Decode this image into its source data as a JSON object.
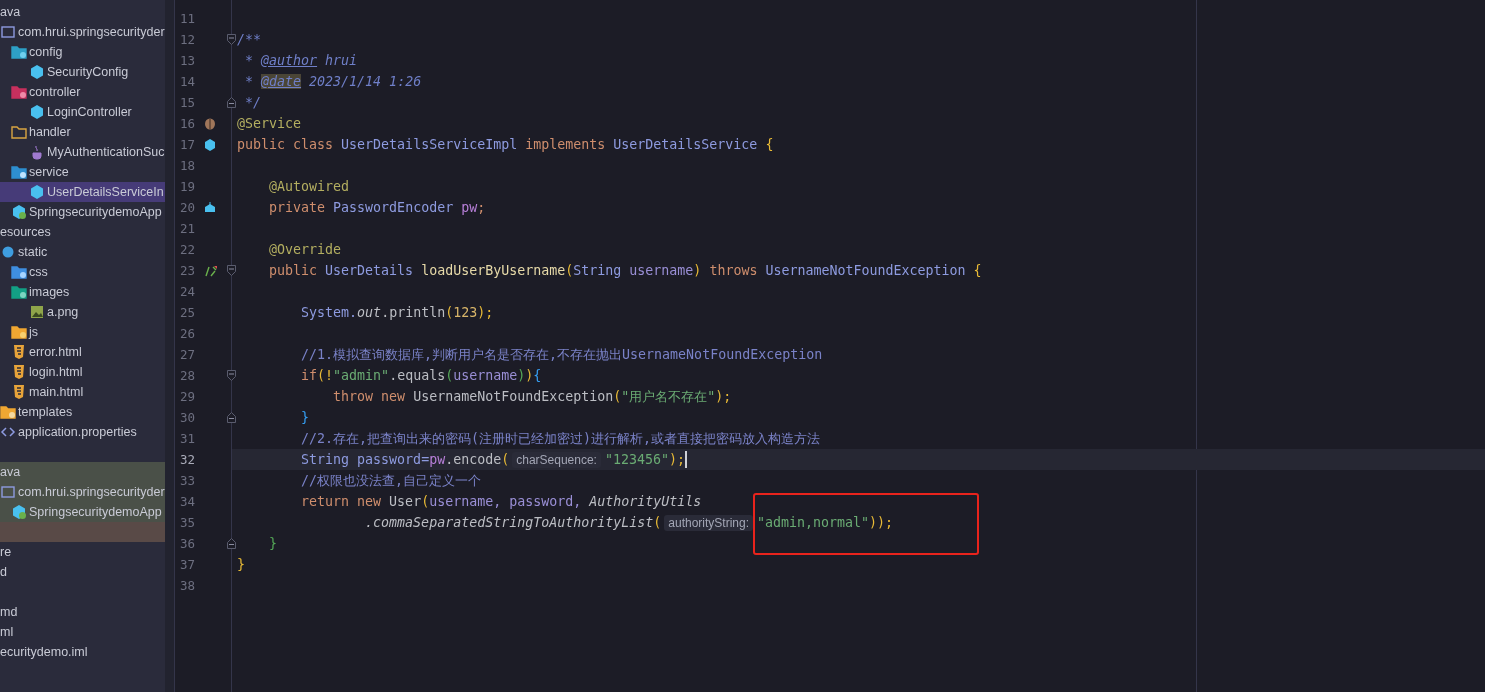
{
  "project_tree": [
    {
      "label": "ava",
      "kind": "plain",
      "selected": false,
      "children": [
        {
          "label": "com.hrui.springsecurityder",
          "kind": "package",
          "selected": false,
          "children": [
            {
              "label": "config",
              "kind": "config-folder",
              "selected": false,
              "children": [
                {
                  "label": "SecurityConfig",
                  "kind": "class",
                  "selected": false
                }
              ]
            },
            {
              "label": "controller",
              "kind": "controller-folder",
              "selected": false,
              "children": [
                {
                  "label": "LoginController",
                  "kind": "class",
                  "selected": false
                }
              ]
            },
            {
              "label": "handler",
              "kind": "folder",
              "selected": false,
              "children": [
                {
                  "label": "MyAuthenticationSuc",
                  "kind": "java",
                  "selected": false
                }
              ]
            },
            {
              "label": "service",
              "kind": "service-folder",
              "selected": false,
              "children": [
                {
                  "label": "UserDetailsServiceIn",
                  "kind": "class",
                  "selected": true
                }
              ]
            },
            {
              "label": "SpringsecuritydemoApp",
              "kind": "app",
              "selected": false
            }
          ]
        }
      ]
    },
    {
      "label": "esources",
      "kind": "plain",
      "selected": false,
      "children": [
        {
          "label": "static",
          "kind": "web-folder",
          "selected": false,
          "children": [
            {
              "label": "css",
              "kind": "css-folder",
              "selected": false
            },
            {
              "label": "images",
              "kind": "image-folder",
              "selected": false,
              "children": [
                {
                  "label": "a.png",
                  "kind": "image",
                  "selected": false
                }
              ]
            },
            {
              "label": "js",
              "kind": "js-folder",
              "selected": false
            },
            {
              "label": "error.html",
              "kind": "html",
              "selected": false
            },
            {
              "label": "login.html",
              "kind": "html",
              "selected": false
            },
            {
              "label": "main.html",
              "kind": "html",
              "selected": false
            }
          ]
        },
        {
          "label": "templates",
          "kind": "templates-folder",
          "selected": false
        },
        {
          "label": "application.properties",
          "kind": "properties",
          "selected": false
        }
      ]
    },
    {
      "kind": "spacer"
    },
    {
      "label": "ava",
      "kind": "plain",
      "selected": false,
      "color": "#4a5048",
      "children": [
        {
          "label": "com.hrui.springsecurityder",
          "kind": "package",
          "selected": false,
          "color": "#4a5048",
          "children": [
            {
              "label": "SpringsecuritydemoApp",
              "kind": "app",
              "selected": false,
              "color": "#4a5048"
            }
          ]
        }
      ]
    },
    {
      "kind": "spacer",
      "color": "#594a47"
    },
    {
      "label": "re",
      "kind": "plain",
      "selected": false
    },
    {
      "label": "d",
      "kind": "plain",
      "selected": false
    },
    {
      "kind": "spacer"
    },
    {
      "label": "md",
      "kind": "plain",
      "selected": false
    },
    {
      "label": "ml",
      "kind": "plain",
      "selected": false
    },
    {
      "label": "ecuritydemo.iml",
      "kind": "plain",
      "selected": false
    }
  ],
  "editor": {
    "lines": [
      {
        "number": "11",
        "current": false
      },
      {
        "number": "12",
        "current": false,
        "fold": {
          "kind": "start"
        },
        "tokens": [
          {
            "text": "/**",
            "kind": "doc"
          }
        ]
      },
      {
        "number": "13",
        "current": false,
        "tokens": [
          {
            "text": " * ",
            "kind": "doc"
          },
          {
            "text": "@author",
            "kind": "doctag"
          },
          {
            "text": " hrui",
            "kind": "doc"
          }
        ]
      },
      {
        "number": "14",
        "current": false,
        "tokens": [
          {
            "text": " * ",
            "kind": "doc"
          },
          {
            "text": "@date",
            "kind": "doctag-marked"
          },
          {
            "text": " 2023/1/14 1:26",
            "kind": "doc"
          }
        ]
      },
      {
        "number": "15",
        "current": false,
        "fold": {
          "kind": "end"
        },
        "tokens": [
          {
            "text": " */",
            "kind": "doc"
          }
        ]
      },
      {
        "number": "16",
        "current": false,
        "marker": {
          "kind": "bean"
        },
        "tokens": [
          {
            "text": "@Service",
            "kind": "annotation"
          }
        ]
      },
      {
        "number": "17",
        "current": false,
        "marker": {
          "kind": "class"
        },
        "tokens": [
          {
            "text": "public class ",
            "kind": "keyword"
          },
          {
            "text": "UserDetailsServiceImpl",
            "kind": "type"
          },
          {
            "text": " implements ",
            "kind": "keyword"
          },
          {
            "text": "UserDetailsService",
            "kind": "type"
          },
          {
            "text": " {",
            "kind": "brace-1"
          }
        ]
      },
      {
        "number": "18",
        "current": false
      },
      {
        "number": "19",
        "current": false,
        "tokens": [
          {
            "text": "    @Autowired",
            "kind": "annotation"
          }
        ]
      },
      {
        "number": "20",
        "current": false,
        "marker": {
          "kind": "autowired"
        },
        "tokens": [
          {
            "text": "    private ",
            "kind": "keyword"
          },
          {
            "text": "PasswordEncoder",
            "kind": "type"
          },
          {
            "text": " pw",
            "kind": "field"
          },
          {
            "text": ";",
            "kind": "keyword"
          }
        ]
      },
      {
        "number": "21",
        "current": false
      },
      {
        "number": "22",
        "current": false,
        "tokens": [
          {
            "text": "    @Override",
            "kind": "annotation"
          }
        ]
      },
      {
        "number": "23",
        "current": false,
        "marker": {
          "kind": "override"
        },
        "fold": {
          "kind": "start"
        },
        "tokens": [
          {
            "text": "    public ",
            "kind": "keyword"
          },
          {
            "text": "UserDetails",
            "kind": "type"
          },
          {
            "text": " loadUserByUsername",
            "kind": "method"
          },
          {
            "text": "(",
            "kind": "brace-1"
          },
          {
            "text": "String",
            "kind": "type"
          },
          {
            "text": " username",
            "kind": "param"
          },
          {
            "text": ")",
            "kind": "brace-1"
          },
          {
            "text": " throws ",
            "kind": "keyword"
          },
          {
            "text": "UsernameNotFoundException",
            "kind": "type"
          },
          {
            "text": " {",
            "kind": "brace-1"
          }
        ]
      },
      {
        "number": "24",
        "current": false
      },
      {
        "number": "25",
        "current": false,
        "tokens": [
          {
            "text": "        System.",
            "kind": "type"
          },
          {
            "text": "out",
            "kind": "static"
          },
          {
            "text": ".println",
            "kind": "plain"
          },
          {
            "text": "(",
            "kind": "brace-1"
          },
          {
            "text": "123",
            "kind": "number"
          },
          {
            "text": ");",
            "kind": "brace-1"
          }
        ]
      },
      {
        "number": "26",
        "current": false
      },
      {
        "number": "27",
        "current": false,
        "tokens": [
          {
            "text": "        //1.模拟查询数据库,判断用户名是否存在,不存在抛出UsernameNotFoundException",
            "kind": "comment"
          }
        ]
      },
      {
        "number": "28",
        "current": false,
        "fold": {
          "kind": "start"
        },
        "tokens": [
          {
            "text": "        if",
            "kind": "keyword"
          },
          {
            "text": "(!",
            "kind": "brace-1"
          },
          {
            "text": "\"admin\"",
            "kind": "string"
          },
          {
            "text": ".equals",
            "kind": "plain"
          },
          {
            "text": "(",
            "kind": "brace-2"
          },
          {
            "text": "username",
            "kind": "param"
          },
          {
            "text": ")",
            "kind": "brace-2"
          },
          {
            "text": ")",
            "kind": "brace-1"
          },
          {
            "text": "{",
            "kind": "brace-3"
          }
        ]
      },
      {
        "number": "29",
        "current": false,
        "tokens": [
          {
            "text": "            throw new ",
            "kind": "keyword"
          },
          {
            "text": "UsernameNotFoundException",
            "kind": "plain"
          },
          {
            "text": "(",
            "kind": "brace-1"
          },
          {
            "text": "\"用户名不存在\"",
            "kind": "string"
          },
          {
            "text": ");",
            "kind": "brace-1"
          }
        ]
      },
      {
        "number": "30",
        "current": false,
        "fold": {
          "kind": "end"
        },
        "tokens": [
          {
            "text": "        }",
            "kind": "brace-3"
          }
        ]
      },
      {
        "number": "31",
        "current": false,
        "tokens": [
          {
            "text": "        //2.存在,把查询出来的密码(注册时已经加密过)进行解析,或者直接把密码放入构造方法",
            "kind": "comment"
          }
        ]
      },
      {
        "number": "32",
        "current": true,
        "tokens": [
          {
            "text": "        String",
            "kind": "type"
          },
          {
            "text": " password=",
            "kind": "type"
          },
          {
            "text": "pw",
            "kind": "field"
          },
          {
            "text": ".encode",
            "kind": "plain"
          },
          {
            "text": "(",
            "kind": "brace-1"
          },
          {
            "text": "charSequence:",
            "kind": "hint"
          },
          {
            "text": "\"123456\"",
            "kind": "string"
          },
          {
            "text": ");",
            "kind": "brace-1"
          }
        ]
      },
      {
        "number": "33",
        "current": false,
        "tokens": [
          {
            "text": "        //权限也没法查,自己定义一个",
            "kind": "comment"
          }
        ]
      },
      {
        "number": "34",
        "current": false,
        "tokens": [
          {
            "text": "        return new ",
            "kind": "keyword"
          },
          {
            "text": "User",
            "kind": "plain"
          },
          {
            "text": "(",
            "kind": "brace-1"
          },
          {
            "text": "username, password, ",
            "kind": "param"
          },
          {
            "text": "AuthorityUtils",
            "kind": "static"
          }
        ]
      },
      {
        "number": "35",
        "current": false,
        "tokens": [
          {
            "text": "                .commaSeparatedStringToAuthorityList",
            "kind": "static"
          },
          {
            "text": "(",
            "kind": "brace-1"
          },
          {
            "text": "authorityString:",
            "kind": "hint"
          },
          {
            "text": "\"admin,normal\"",
            "kind": "string",
            "framed": true
          },
          {
            "text": "));",
            "kind": "brace-1"
          }
        ]
      },
      {
        "number": "36",
        "current": false,
        "fold": {
          "kind": "end"
        },
        "tokens": [
          {
            "text": "    }",
            "kind": "brace-2"
          }
        ]
      },
      {
        "number": "37",
        "current": false,
        "tokens": [
          {
            "text": "}",
            "kind": "brace-1"
          }
        ]
      },
      {
        "number": "38",
        "current": false
      }
    ]
  }
}
